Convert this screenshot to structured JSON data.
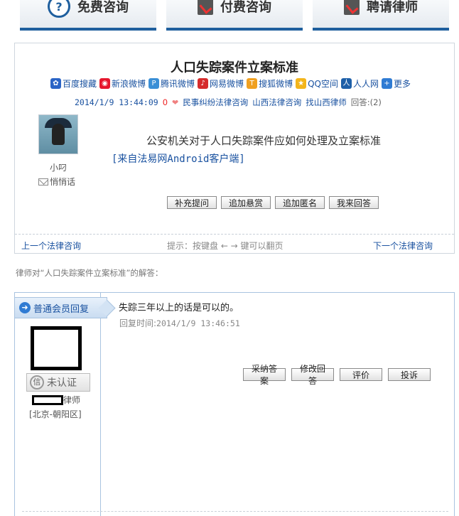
{
  "top_tabs": [
    {
      "label": "免费咨询",
      "icon": "question-circle-icon"
    },
    {
      "label": "付费咨询",
      "icon": "checklist-icon"
    },
    {
      "label": "聘请律师",
      "icon": "checklist-icon"
    }
  ],
  "question": {
    "title": "人口失踪案件立案标准",
    "share": [
      {
        "label": "百度搜藏",
        "icon": "baidu-icon",
        "color": "#2a64c6"
      },
      {
        "label": "新浪微博",
        "icon": "sina-weibo-icon",
        "color": "#e6162d"
      },
      {
        "label": "腾讯微博",
        "icon": "tencent-weibo-icon",
        "color": "#3a8fd6"
      },
      {
        "label": "网易微博",
        "icon": "netease-weibo-icon",
        "color": "#d62b2b"
      },
      {
        "label": "搜狐微博",
        "icon": "sohu-weibo-icon",
        "color": "#f0a020"
      },
      {
        "label": "QQ空间",
        "icon": "qzone-icon",
        "color": "#f3b51b"
      },
      {
        "label": "人人网",
        "icon": "renren-icon",
        "color": "#1d5fa8"
      },
      {
        "label": "更多",
        "icon": "plus-icon",
        "color": "#2f7bd3"
      }
    ],
    "date": "2014/1/9 13:44:09",
    "likes": "0",
    "category": "民事纠纷法律咨询",
    "region": "山西法律咨询",
    "find_lawyer": "找山西律师",
    "reply_label": "回答:",
    "reply_count": "(2)",
    "user_name": "小叼",
    "pm_label": "悄悄话",
    "body": "公安机关对于人口失踪案件应如何处理及立案标准",
    "source": "[来自法易网Android客户端]",
    "actions": [
      "补充提问",
      "追加悬赏",
      "追加匿名",
      "我来回答"
    ]
  },
  "nav": {
    "prev": "上一个法律咨询",
    "hint": "提示：按键盘 ← → 键可以翻页",
    "next": "下一个法律咨询"
  },
  "answers_label": "律师对“人口失踪案件立案标准”的解答：",
  "answer": {
    "badge": "普通会员回复",
    "verify": "未认证",
    "lawyer_suffix": "律师",
    "location": "[北京-朝阳区]",
    "text": "失踪三年以上的话是可以的。",
    "time_label": "回复时间:",
    "time": "2014/1/9 13:46:51",
    "actions": [
      "采纳答案",
      "修改回答",
      "评价",
      "投诉"
    ]
  }
}
